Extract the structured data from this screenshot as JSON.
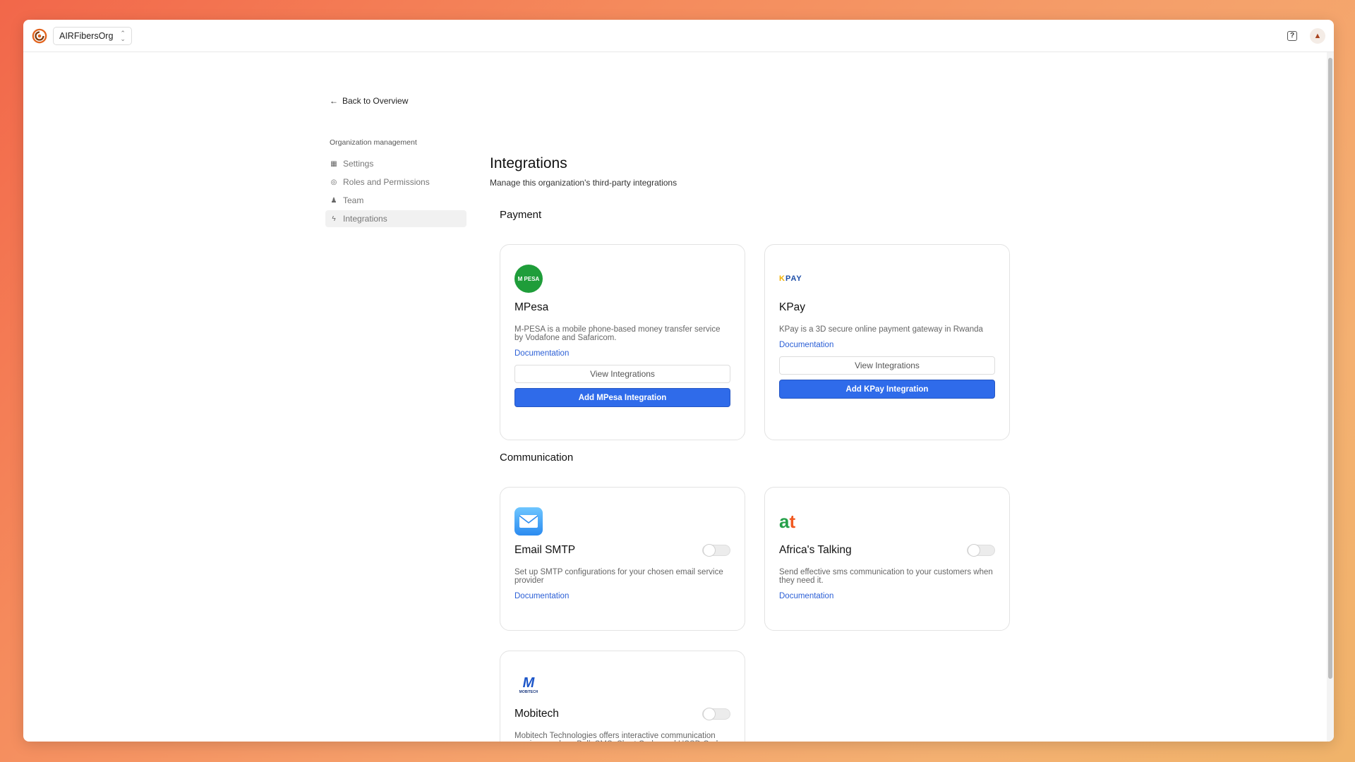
{
  "topbar": {
    "org_name": "AIRFibersOrg"
  },
  "nav": {
    "back_label": "Back to Overview",
    "heading": "Organization management",
    "items": [
      {
        "label": "Settings",
        "icon": "building-icon"
      },
      {
        "label": "Roles and Permissions",
        "icon": "shield-icon"
      },
      {
        "label": "Team",
        "icon": "user-icon"
      },
      {
        "label": "Integrations",
        "icon": "plug-icon",
        "active": true
      }
    ]
  },
  "page": {
    "title": "Integrations",
    "subtitle": "Manage this organization's third-party integrations"
  },
  "sections": {
    "payment": "Payment",
    "communication": "Communication"
  },
  "cards": {
    "mpesa": {
      "logo_text": "M PESA",
      "name": "MPesa",
      "desc": "M-PESA is a mobile phone-based money transfer service by Vodafone and Safaricom.",
      "doc": "Documentation",
      "view": "View Integrations",
      "add": "Add MPesa Integration"
    },
    "kpay": {
      "logo_k": "K",
      "logo_rest": "PAY",
      "name": "KPay",
      "desc": "KPay is a 3D secure online payment gateway in Rwanda",
      "doc": "Documentation",
      "view": "View Integrations",
      "add": "Add KPay Integration"
    },
    "smtp": {
      "name": "Email SMTP",
      "desc": "Set up SMTP configurations for your chosen email service provider",
      "doc": "Documentation",
      "enabled": false
    },
    "africastalking": {
      "logo_a": "a",
      "logo_t": "t",
      "name": "Africa's Talking",
      "desc": "Send effective sms communication to your customers when they need it.",
      "doc": "Documentation",
      "enabled": false
    },
    "mobitech": {
      "logo_m": "M",
      "logo_text": "MOBITECH",
      "name": "Mobitech",
      "desc": "Mobitech Technologies offers interactive communication services such as Bulk SMS, Short Code, and USSD Codes.",
      "enabled": false
    }
  },
  "colors": {
    "primary": "#2f6bea",
    "link": "#2b5fd6",
    "mpesa_green": "#1f9d3a"
  }
}
